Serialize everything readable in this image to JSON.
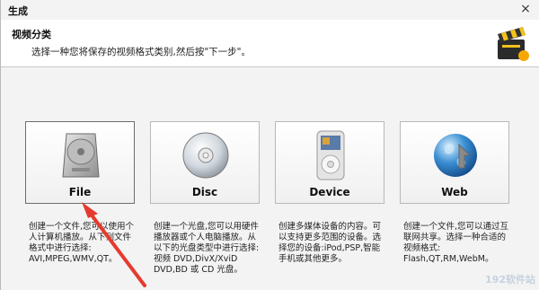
{
  "window": {
    "title": "生成",
    "close_glyph": "×"
  },
  "header": {
    "section_title": "视频分类",
    "instruction": "选择一种您将保存的视频格式类别,然后按\"下一步\"。",
    "icon": "clapperboard-icon"
  },
  "options": [
    {
      "label": "File",
      "icon": "hard-drive-icon",
      "desc": [
        "创建一个文件,您可以使用个",
        "人计算机播放。从下列文件",
        "格式中进行选择:",
        "AVI,MPEG,WMV,QT。"
      ]
    },
    {
      "label": "Disc",
      "icon": "disc-icon",
      "desc": [
        "创建一个光盘,您可以用硬件",
        "播放器或个人电脑播放。从",
        "以下的光盘类型中进行选择:视频 DVD,DivX/XviD",
        "DVD,BD 或 CD 光盘。"
      ]
    },
    {
      "label": "Device",
      "icon": "media-player-icon",
      "desc": [
        "创建多媒体设备的内容。可",
        "以支持更多范围的设备。选",
        "择您的设备:iPod,PSP,智能",
        "手机或其他更多。"
      ]
    },
    {
      "label": "Web",
      "icon": "globe-icon",
      "desc": [
        "创建一个文件,您可以通过互",
        "联网共享。选择一种合适的",
        "视频格式:",
        "Flash,QT,RM,WebM。"
      ]
    }
  ],
  "watermark": "192软件站",
  "colors": {
    "arrow": "#e53b2e",
    "selected_border": "#6c6c6c"
  }
}
